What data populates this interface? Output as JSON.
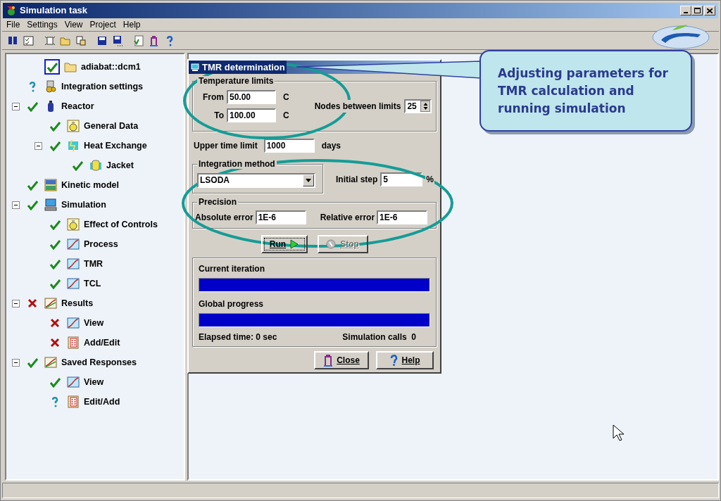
{
  "window": {
    "title": "Simulation task"
  },
  "menu": [
    "File",
    "Settings",
    "View",
    "Project",
    "Help"
  ],
  "tree": [
    {
      "label": "adiabat::dcm1",
      "kind": "ok",
      "selected": true,
      "children": [
        {
          "label": "Integration settings",
          "kind": "unknown",
          "selected": false
        },
        {
          "label": "Reactor",
          "kind": "ok",
          "selected": false,
          "expanded": true,
          "children": [
            {
              "label": "General Data",
              "kind": "ok",
              "selected": false
            },
            {
              "label": "Heat Exchange",
              "kind": "ok",
              "selected": false,
              "expanded": true,
              "children": [
                {
                  "label": "Jacket",
                  "kind": "ok",
                  "selected": false
                }
              ]
            }
          ]
        },
        {
          "label": "Kinetic model",
          "kind": "ok",
          "selected": false
        },
        {
          "label": "Simulation",
          "kind": "ok",
          "selected": false,
          "expanded": true,
          "children": [
            {
              "label": "Effect of Controls",
              "kind": "ok",
              "selected": false
            },
            {
              "label": "Process",
              "kind": "ok",
              "selected": false
            },
            {
              "label": "TMR",
              "kind": "ok",
              "selected": false
            },
            {
              "label": "TCL",
              "kind": "ok",
              "selected": false
            }
          ]
        },
        {
          "label": "Results",
          "kind": "error",
          "selected": false,
          "expanded": true,
          "children": [
            {
              "label": "View",
              "kind": "error",
              "selected": false
            },
            {
              "label": "Add/Edit",
              "kind": "error",
              "selected": false
            }
          ]
        },
        {
          "label": "Saved Responses",
          "kind": "ok",
          "selected": false,
          "expanded": true,
          "children": [
            {
              "label": "View",
              "kind": "ok",
              "selected": false
            },
            {
              "label": "Edit/Add",
              "kind": "unknown",
              "selected": false
            }
          ]
        }
      ]
    }
  ],
  "dialog": {
    "title": "TMR determination",
    "temperature": {
      "legend": "Temperature limits",
      "from_label": "From",
      "from_value": "50.00",
      "to_label": "To",
      "to_value": "100.00",
      "unit_from": "C",
      "unit_to": "C",
      "nodes_label": "Nodes between limits",
      "nodes_value": "25"
    },
    "upper_time": {
      "label": "Upper time limit",
      "value": "1000",
      "unit": "days"
    },
    "integration": {
      "legend": "Integration method",
      "value": "LSODA",
      "step_label": "Initial step",
      "step_value": "5",
      "step_unit": "%"
    },
    "precision": {
      "legend": "Precision",
      "abs_label": "Absolute error",
      "abs_value": "1E-6",
      "rel_label": "Relative error",
      "rel_value": "1E-6"
    },
    "run": {
      "label": "Run",
      "disabled": false
    },
    "stop": {
      "label": "Stop",
      "disabled": true
    },
    "progress": [
      {
        "label": "Current iteration",
        "level": 1
      },
      {
        "label": "Global progress",
        "level": 1
      }
    ],
    "elapsed": "Elapsed time: 0 sec",
    "calls": "Simulation calls  0",
    "close": "Close",
    "help": "Help"
  },
  "callout": "Adjusting parameters for TMR calculation and running simulation"
}
